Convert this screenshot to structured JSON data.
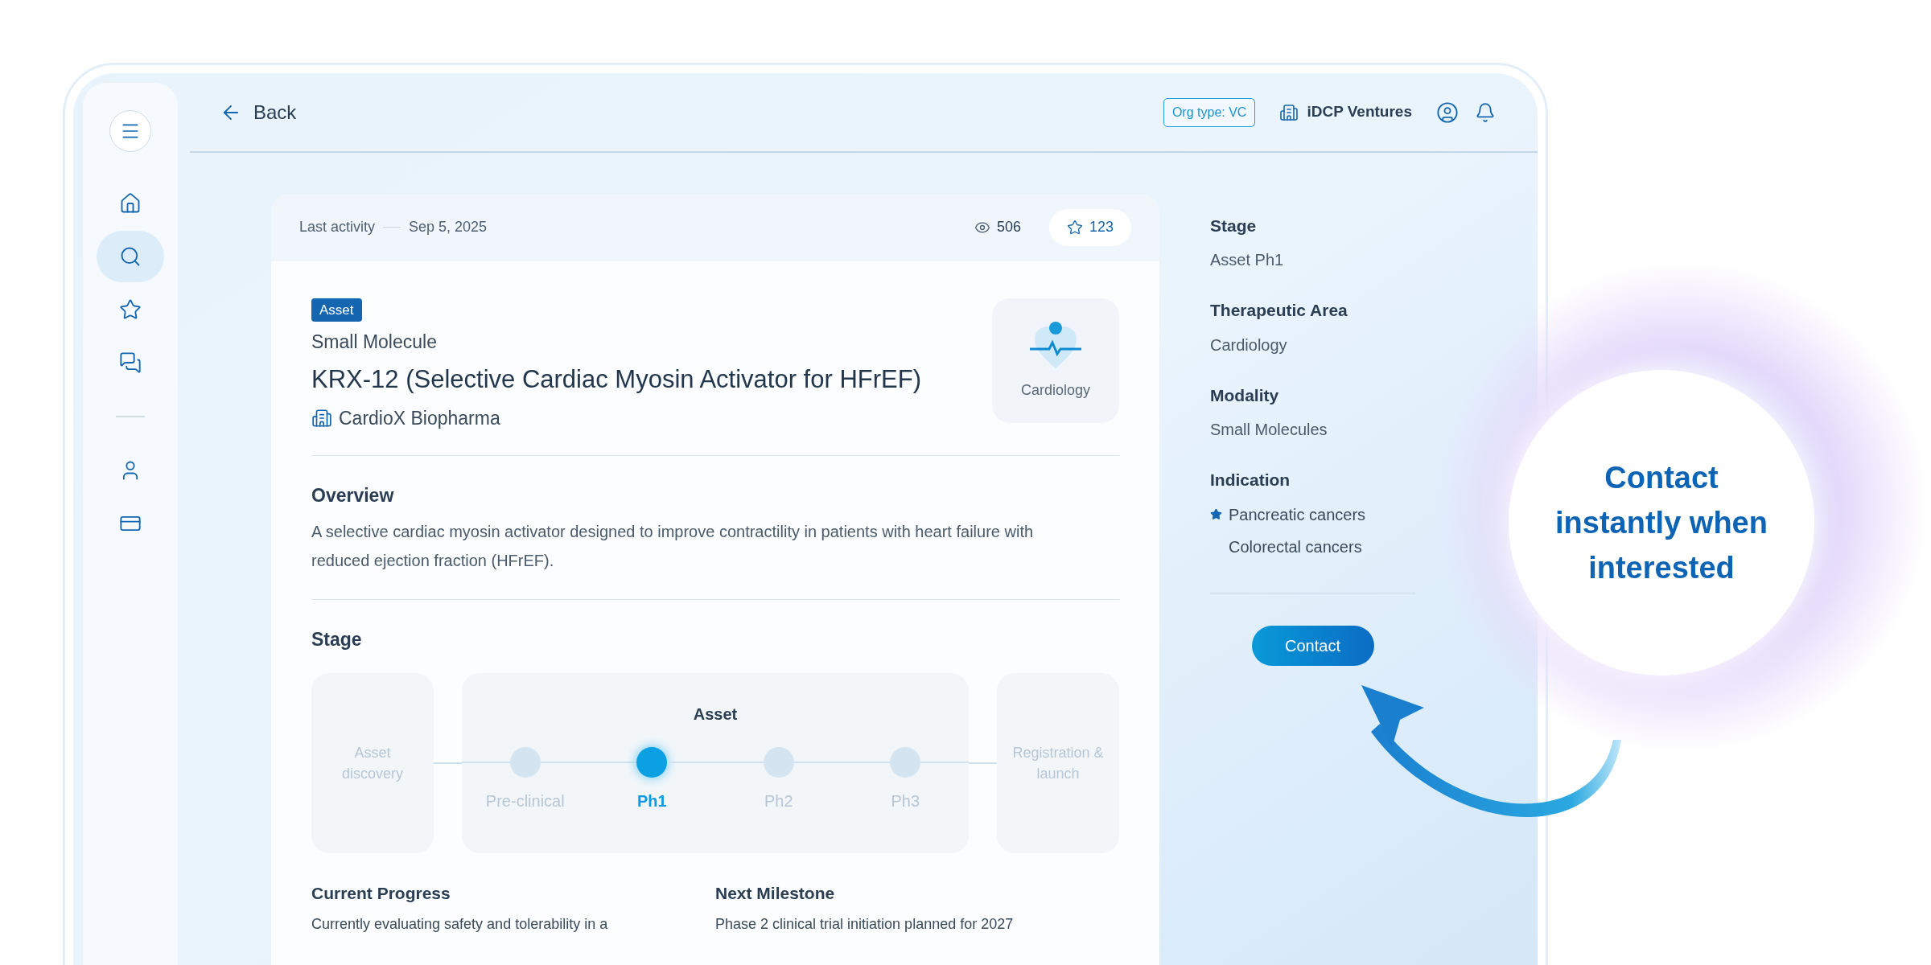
{
  "header": {
    "back": "Back",
    "org_type": "Org type: VC",
    "org_name": "iDCP Ventures"
  },
  "sidebar": {
    "items": [
      {
        "selected": false
      },
      {
        "selected": true
      },
      {
        "selected": false
      },
      {
        "selected": false
      }
    ],
    "bottom_items": [
      {
        "selected": false
      },
      {
        "selected": false
      }
    ]
  },
  "card": {
    "last_activity_label": "Last activity",
    "last_activity_date": "Sep 5, 2025",
    "views": "506",
    "favorites": "123",
    "tag": "Asset",
    "modality": "Small Molecule",
    "title": "KRX-12 (Selective Cardiac Myosin Activator for HFrEF)",
    "company": "CardioX Biopharma",
    "area_tile": "Cardiology",
    "overview": {
      "heading": "Overview",
      "text": "A selective cardiac myosin activator designed to improve contractility in patients with heart failure with reduced ejection fraction (HFrEF)."
    },
    "stage": {
      "heading": "Stage",
      "before": "Asset discovery",
      "group": "Asset",
      "after": "Registration & launch",
      "steps": [
        {
          "label": "Pre-clinical",
          "selected": false
        },
        {
          "label": "Ph1",
          "selected": true
        },
        {
          "label": "Ph2",
          "selected": false
        },
        {
          "label": "Ph3",
          "selected": false
        }
      ]
    },
    "progress": {
      "heading": "Current Progress",
      "text": "Currently evaluating safety and tolerability in a"
    },
    "milestone": {
      "heading": "Next Milestone",
      "text": "Phase 2 clinical trial initiation planned for 2027"
    }
  },
  "details": {
    "fields": [
      {
        "label": "Stage",
        "value": "Asset Ph1"
      },
      {
        "label": "Therapeutic Area",
        "value": "Cardiology"
      },
      {
        "label": "Modality",
        "value": "Small Molecules"
      }
    ],
    "indication": {
      "label": "Indication",
      "items": [
        {
          "text": "Pancreatic cancers",
          "starred": true
        },
        {
          "text": "Colorectal cancers",
          "starred": false
        }
      ]
    },
    "contact": "Contact"
  },
  "callout": "Contact instantly when interested"
}
